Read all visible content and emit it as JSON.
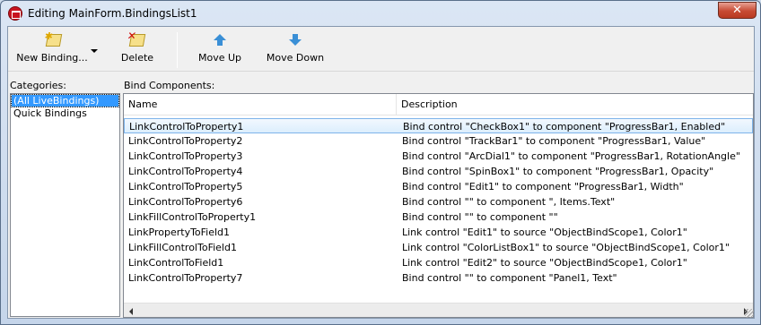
{
  "window": {
    "title": "Editing MainForm.BindingsList1",
    "close_label": "✕"
  },
  "toolbar": {
    "new_binding": "New Binding...",
    "delete": "Delete",
    "move_up": "Move Up",
    "move_down": "Move Down"
  },
  "categories": {
    "label": "Categories:",
    "items": [
      "(All LiveBindings)",
      "Quick Bindings"
    ],
    "selected_index": 0
  },
  "components": {
    "label": "Bind Components:",
    "columns": [
      "Name",
      "Description"
    ],
    "rows": [
      {
        "name": "LinkControlToProperty1",
        "description": "Bind control \"CheckBox1\" to component \"ProgressBar1, Enabled\""
      },
      {
        "name": "LinkControlToProperty2",
        "description": "Bind control \"TrackBar1\" to component \"ProgressBar1, Value\""
      },
      {
        "name": "LinkControlToProperty3",
        "description": "Bind control \"ArcDial1\" to component \"ProgressBar1, RotationAngle\""
      },
      {
        "name": "LinkControlToProperty4",
        "description": "Bind control \"SpinBox1\" to component \"ProgressBar1, Opacity\""
      },
      {
        "name": "LinkControlToProperty5",
        "description": "Bind control \"Edit1\" to component \"ProgressBar1, Width\""
      },
      {
        "name": "LinkControlToProperty6",
        "description": "Bind control \"\" to component \", Items.Text\""
      },
      {
        "name": "LinkFillControlToProperty1",
        "description": "Bind control \"\" to component \"\""
      },
      {
        "name": "LinkPropertyToField1",
        "description": "Link control \"Edit1\" to source \"ObjectBindScope1, Color1\""
      },
      {
        "name": "LinkFillControlToField1",
        "description": "Link control \"ColorListBox1\" to source \"ObjectBindScope1, Color1\""
      },
      {
        "name": "LinkControlToField1",
        "description": "Link control \"Edit2\" to source \"ObjectBindScope1, Color1\""
      },
      {
        "name": "LinkControlToProperty7",
        "description": "Bind control \"\" to component \"Panel1, Text\""
      }
    ],
    "selected_index": 0
  }
}
